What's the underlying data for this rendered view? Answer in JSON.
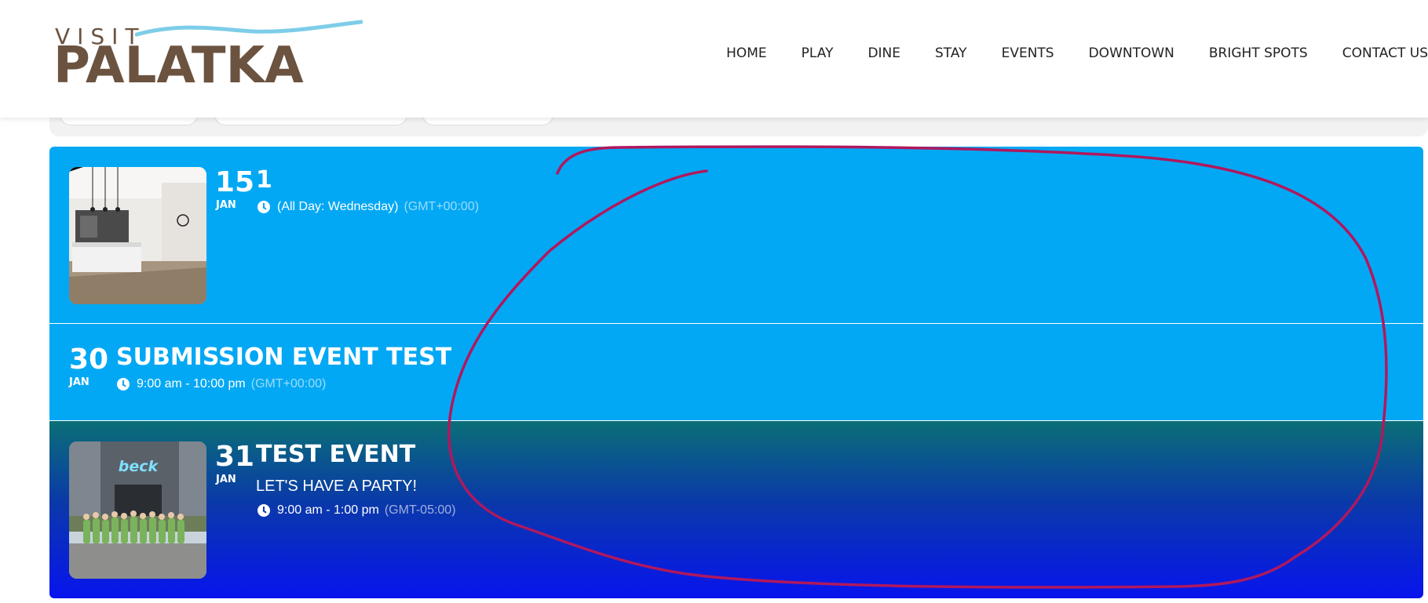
{
  "header": {
    "logo_top": "VISIT",
    "logo_main": "PALATKA",
    "nav": [
      "HOME",
      "PLAY",
      "DINE",
      "STAY",
      "EVENTS",
      "DOWNTOWN",
      "BRIGHT SPOTS",
      "CONTACT US"
    ]
  },
  "events": [
    {
      "day": "15",
      "month": "JAN",
      "title": "1",
      "time": "(All Day: Wednesday)",
      "timezone": "(GMT+00:00)",
      "image": "kitchen-interior-photo"
    },
    {
      "day": "30",
      "month": "JAN",
      "title": "SUBMISSION EVENT TEST",
      "time": "9:00 am - 10:00 pm",
      "timezone": "(GMT+00:00)"
    },
    {
      "day": "31",
      "month": "JAN",
      "title": "TEST EVENT",
      "subtitle": "LET'S HAVE A PARTY!",
      "time": "9:00 am - 1:00 pm",
      "timezone": "(GMT-05:00)",
      "image": "beck-storefront-group-photo"
    }
  ],
  "colors": {
    "brand_brown": "#6b5340",
    "brand_wave": "#7dcde8",
    "event_blue": "#03a8f4",
    "gradient_top": "#0b6f76",
    "gradient_bottom": "#0714ee",
    "annotation": "#b0185e"
  },
  "icons": {
    "time": "clock-icon"
  }
}
